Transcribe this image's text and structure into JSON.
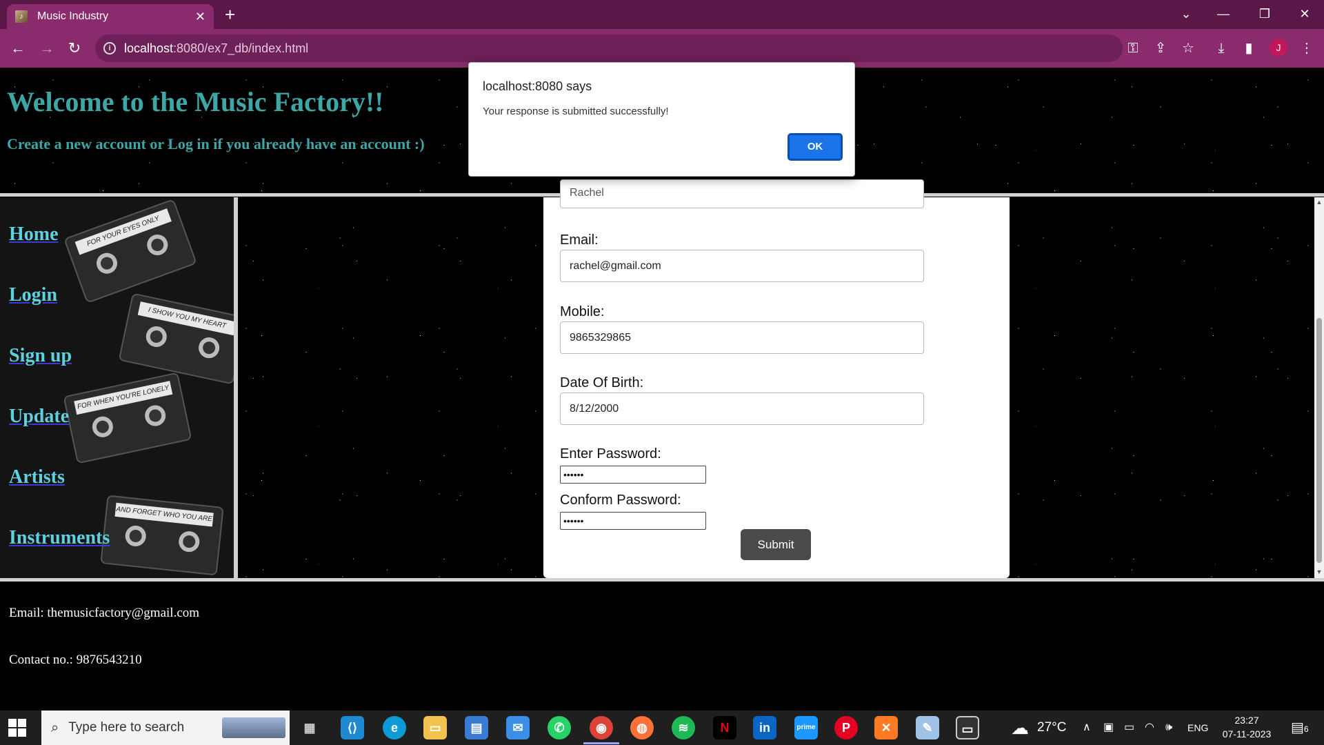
{
  "browser": {
    "tab_title": "Music Industry",
    "tab_close": "✕",
    "new_tab": "+",
    "url_host": "localhost",
    "url_path": ":8080/ex7_db/index.html",
    "avatar_initial": "J",
    "accent": "#8a2b6e"
  },
  "page": {
    "welcome": "Welcome to the Music Factory!!",
    "subtitle": "Create a new account or Log in if you already have an account :)",
    "nav": [
      "Home",
      "Login",
      "Sign up",
      "Update",
      "Artists",
      "Instruments"
    ],
    "cassette_labels": [
      "FOR YOUR EYES ONLY",
      "I SHOW YOU MY HEART",
      "FOR WHEN YOU'RE LONELY",
      "AND FORGET WHO YOU ARE"
    ]
  },
  "form": {
    "name_partial": "Rachel",
    "email_label": "Email:",
    "email_value": "rachel@gmail.com",
    "mobile_label": "Mobile:",
    "mobile_value": "9865329865",
    "dob_label": "Date Of Birth:",
    "dob_value": "8/12/2000",
    "password_label": "Enter Password:",
    "password_value": "••••••",
    "confirm_label": "Conform Password:",
    "confirm_value": "••••••",
    "submit": "Submit"
  },
  "footer": {
    "email": "Email: themusicfactory@gmail.com",
    "contact": "Contact no.: 9876543210"
  },
  "dialog": {
    "title": "localhost:8080 says",
    "message": "Your response is submitted successfully!",
    "ok": "OK"
  },
  "taskbar": {
    "search_placeholder": "Type here to search",
    "weather": "27°C",
    "language": "ENG",
    "time": "23:27",
    "date": "07-11-2023",
    "notifications": "6"
  }
}
